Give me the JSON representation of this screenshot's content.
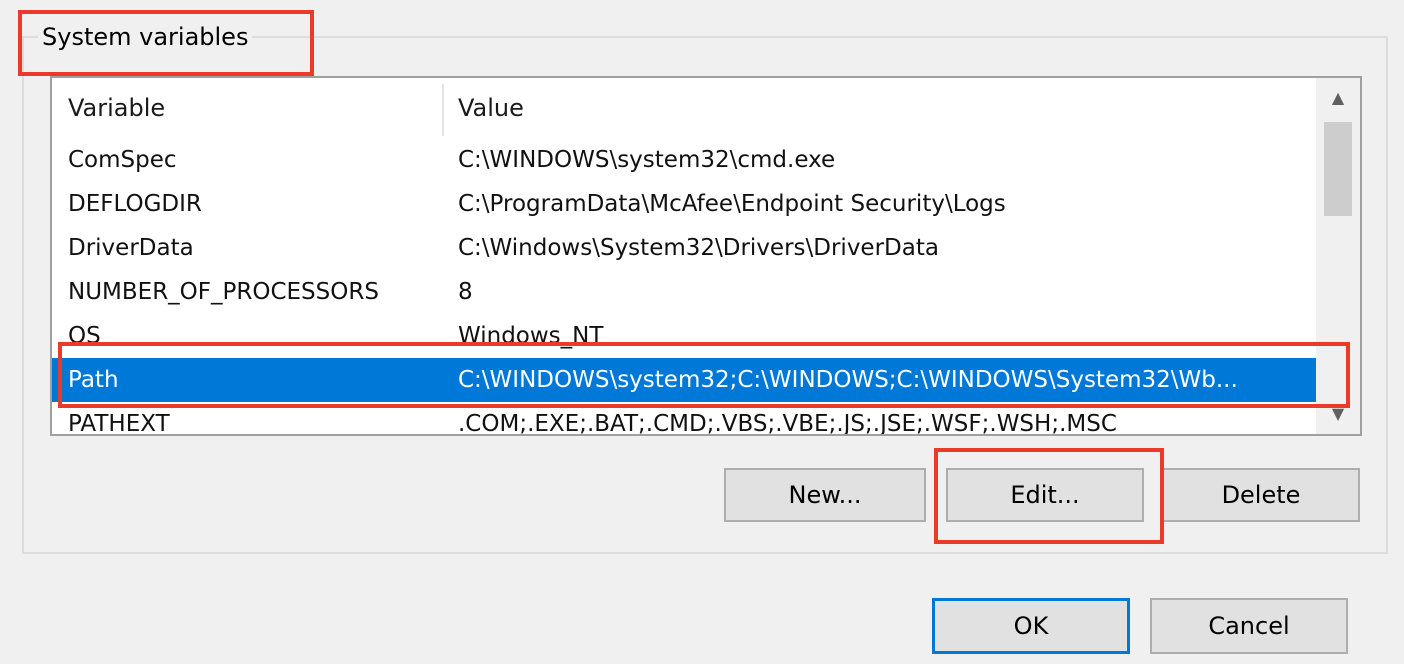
{
  "group": {
    "title": "System variables"
  },
  "table": {
    "columns": {
      "variable": "Variable",
      "value": "Value"
    },
    "rows": [
      {
        "variable": "ComSpec",
        "value": "C:\\WINDOWS\\system32\\cmd.exe"
      },
      {
        "variable": "DEFLOGDIR",
        "value": "C:\\ProgramData\\McAfee\\Endpoint Security\\Logs"
      },
      {
        "variable": "DriverData",
        "value": "C:\\Windows\\System32\\Drivers\\DriverData"
      },
      {
        "variable": "NUMBER_OF_PROCESSORS",
        "value": "8"
      },
      {
        "variable": "OS",
        "value": "Windows_NT"
      },
      {
        "variable": "Path",
        "value": "C:\\WINDOWS\\system32;C:\\WINDOWS;C:\\WINDOWS\\System32\\Wb..."
      },
      {
        "variable": "PATHEXT",
        "value": ".COM;.EXE;.BAT;.CMD;.VBS;.VBE;.JS;.JSE;.WSF;.WSH;.MSC"
      }
    ],
    "selected_variable": "Path"
  },
  "scrollbar": {
    "up_icon": "chevron-up-icon",
    "down_icon": "chevron-down-icon"
  },
  "buttons": {
    "new": "New...",
    "edit": "Edit...",
    "delete": "Delete",
    "ok": "OK",
    "cancel": "Cancel"
  },
  "colors": {
    "highlight": "#ea3a2a",
    "selection": "#0078d7"
  }
}
